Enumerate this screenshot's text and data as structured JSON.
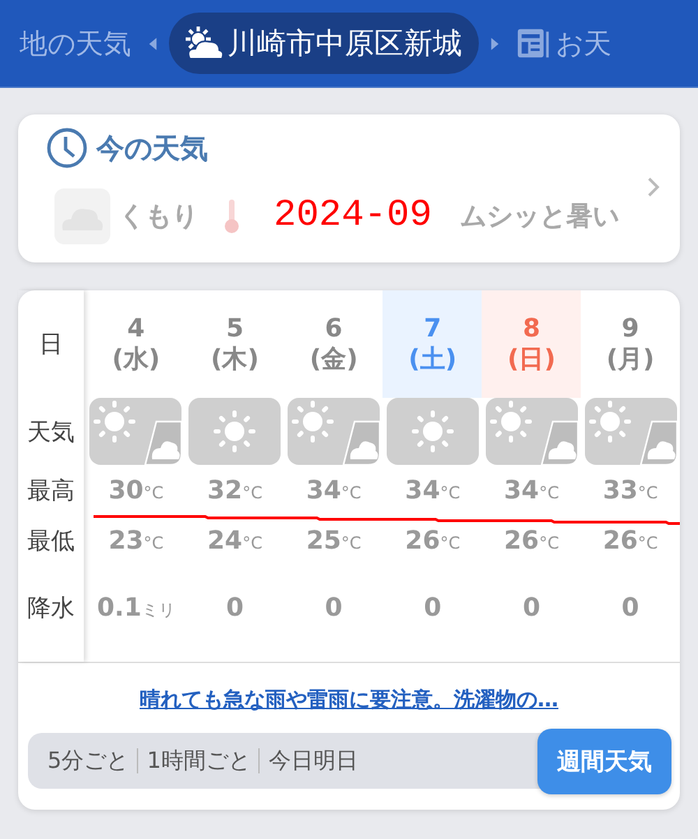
{
  "header": {
    "tabs": [
      {
        "label": "地の天気",
        "kind": "plain",
        "selected": false
      },
      {
        "label": "川崎市中原区新城",
        "kind": "location",
        "selected": true
      },
      {
        "label": "お天",
        "kind": "news",
        "selected": false
      }
    ]
  },
  "current": {
    "title": "今の天気",
    "condition": "くもり",
    "comment": "ムシッと暑い"
  },
  "weekly": {
    "row_labels": [
      "日",
      "天気",
      "最高",
      "最低",
      "降水"
    ],
    "days": [
      {
        "date": "4",
        "weekday": "(水)",
        "kind": "weekday",
        "weather": {
          "kind": "sun_cloud"
        },
        "high": {
          "value": "30",
          "unit": "°C"
        },
        "low": {
          "value": "23",
          "unit": "°C"
        },
        "rain": {
          "value": "0.1",
          "unit": "ミリ"
        }
      },
      {
        "date": "5",
        "weekday": "(木)",
        "kind": "weekday",
        "weather": {
          "kind": "sun"
        },
        "high": {
          "value": "32",
          "unit": "°C"
        },
        "low": {
          "value": "24",
          "unit": "°C"
        },
        "rain": {
          "value": "0"
        }
      },
      {
        "date": "6",
        "weekday": "(金)",
        "kind": "weekday",
        "weather": {
          "kind": "sun_cloud"
        },
        "high": {
          "value": "34",
          "unit": "°C"
        },
        "low": {
          "value": "25",
          "unit": "°C"
        },
        "rain": {
          "value": "0"
        }
      },
      {
        "date": "7",
        "weekday": "(土)",
        "kind": "saturday",
        "weather": {
          "kind": "sun"
        },
        "high": {
          "value": "34",
          "unit": "°C"
        },
        "low": {
          "value": "26",
          "unit": "°C"
        },
        "rain": {
          "value": "0"
        }
      },
      {
        "date": "8",
        "weekday": "(日)",
        "kind": "sunday",
        "weather": {
          "kind": "sun_cloud"
        },
        "high": {
          "value": "34",
          "unit": "°C"
        },
        "low": {
          "value": "26",
          "unit": "°C"
        },
        "rain": {
          "value": "0"
        }
      },
      {
        "date": "9",
        "weekday": "(月)",
        "kind": "weekday",
        "weather": {
          "kind": "sun_cloud"
        },
        "high": {
          "value": "33",
          "unit": "°C"
        },
        "low": {
          "value": "26",
          "unit": "°C"
        },
        "rain": {
          "value": "0"
        }
      }
    ],
    "link": "晴れても急な雨や雷雨に要注意。洗濯物の…",
    "segments": [
      {
        "label": "5分ごと",
        "selected": false
      },
      {
        "label": "1時間ごと",
        "selected": false
      },
      {
        "label": "今日明日",
        "selected": false
      },
      {
        "label": "週間天気",
        "selected": true
      }
    ]
  },
  "annotation": {
    "text": "2024-09"
  }
}
